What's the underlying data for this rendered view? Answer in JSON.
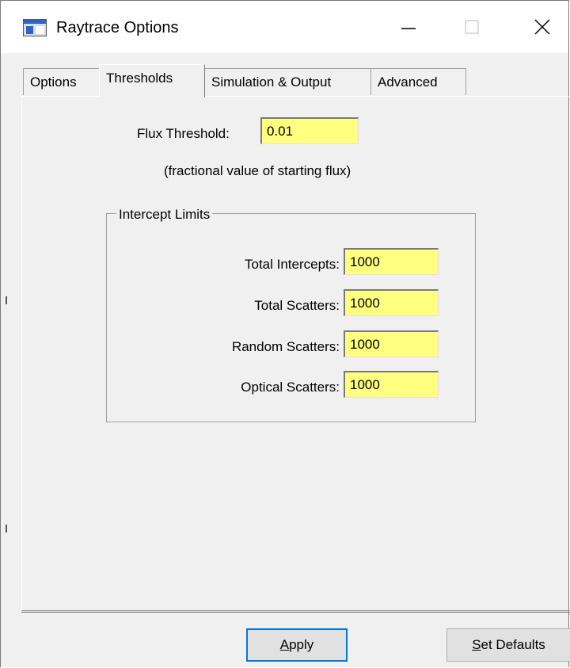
{
  "window": {
    "title": "Raytrace Options",
    "icons": {
      "app": "window-app-icon",
      "minimize": "minimize-icon",
      "maximize": "maximize-icon",
      "close": "close-icon"
    }
  },
  "tabs": [
    {
      "label": "Options",
      "active": false
    },
    {
      "label": "Thresholds",
      "active": true
    },
    {
      "label": "Simulation & Output",
      "active": false
    },
    {
      "label": "Advanced",
      "active": false
    }
  ],
  "thresholds": {
    "flux_label": "Flux Threshold:",
    "flux_value": "0.01",
    "flux_note": "(fractional value of starting flux)",
    "group_title": "Intercept Limits",
    "limits": [
      {
        "label": "Total Intercepts:",
        "value": "1000"
      },
      {
        "label": "Total Scatters:",
        "value": "1000"
      },
      {
        "label": "Random Scatters:",
        "value": "1000"
      },
      {
        "label": "Optical Scatters:",
        "value": "1000"
      }
    ]
  },
  "buttons": {
    "apply_mnemonic": "A",
    "apply_rest": "pply",
    "defaults_mnemonic": "S",
    "defaults_rest": "et Defaults"
  },
  "colors": {
    "field_background": "#ffff80",
    "dialog_background": "#f0f0f0",
    "accent": "#0078d7"
  }
}
